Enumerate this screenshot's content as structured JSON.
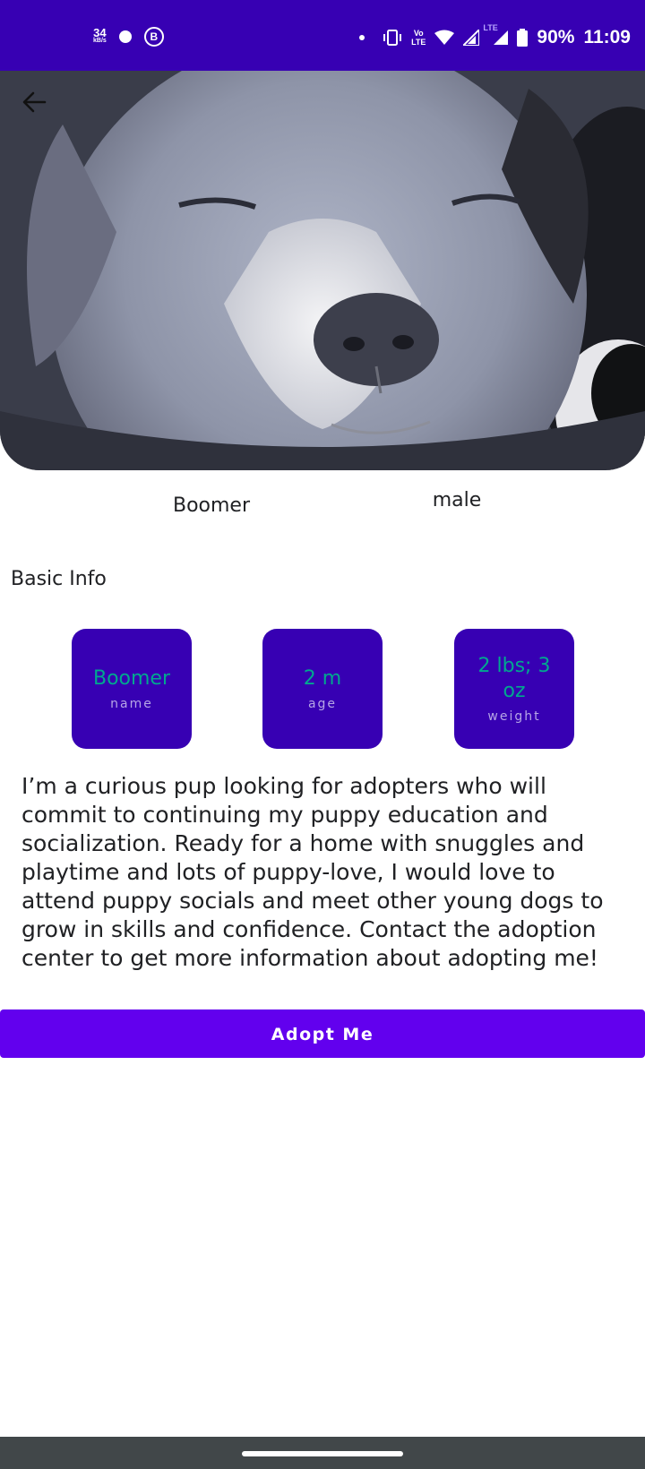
{
  "status_bar": {
    "net_speed_value": "34",
    "net_speed_unit": "kB/s",
    "app_badge": "B",
    "volte_line1": "Vo",
    "volte_line2": "LTE",
    "lte_label": "LTE",
    "battery": "90%",
    "time": "11:09"
  },
  "hero_image": {
    "subject": "grey puppy with eyes closed"
  },
  "pet": {
    "name": "Boomer",
    "sex": "male"
  },
  "section_title": "Basic Info",
  "info_cards": [
    {
      "value": "Boomer",
      "label": "name"
    },
    {
      "value": "2 m",
      "label": "age"
    },
    {
      "value": "2 lbs; 3 oz",
      "label": "weight"
    }
  ],
  "description": "I’m a curious pup looking for adopters who will commit to continuing my puppy education and socialization. Ready for a home with snuggles and playtime and lots of puppy-love, I would love to attend puppy socials and meet other young dogs to grow in skills and confidence. Contact the adoption center to get more information about adopting me!",
  "adopt_button": "Adopt Me",
  "icons": {
    "back": "arrow-back-icon",
    "home": "home-gesture-handle"
  },
  "colors": {
    "primary_dark": "#3700b3",
    "primary": "#6200ee",
    "card_value": "#01a88f"
  }
}
